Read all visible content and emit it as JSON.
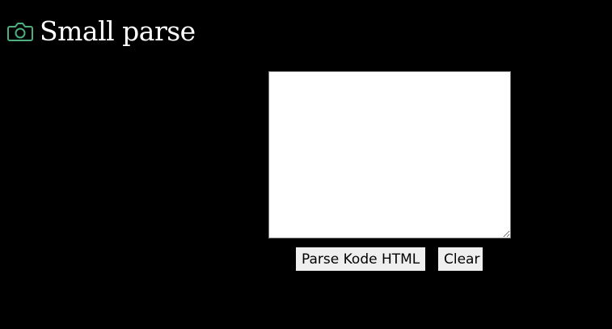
{
  "header": {
    "title": "Small parse",
    "icon": "camera-icon",
    "icon_color": "#4caf7d"
  },
  "editor": {
    "value": "",
    "placeholder": ""
  },
  "buttons": {
    "parse_label": "Parse Kode HTML",
    "clear_label": "Clear"
  },
  "colors": {
    "background": "#000000",
    "title_text": "#ffffff",
    "button_bg": "#efefef"
  }
}
